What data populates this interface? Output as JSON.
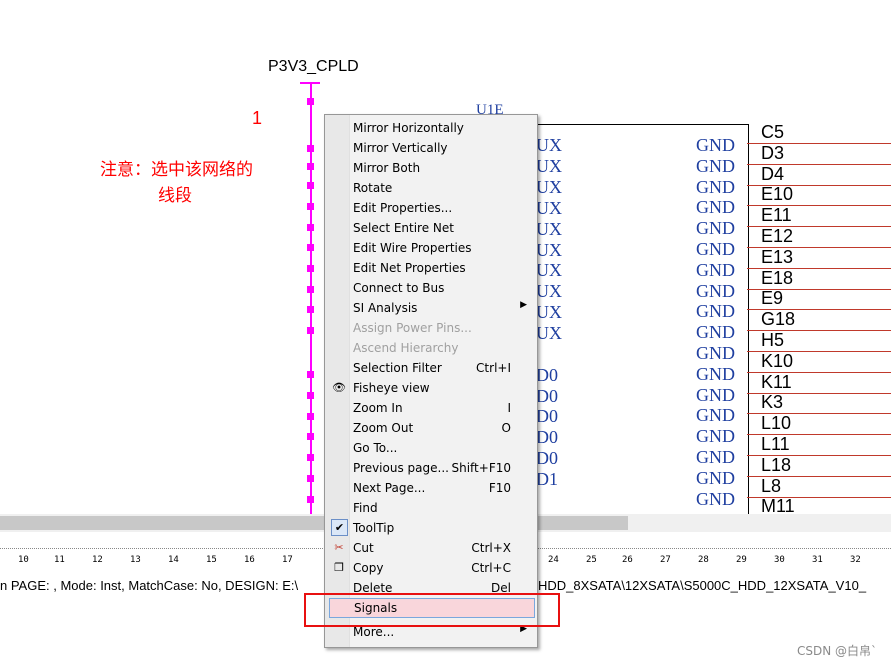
{
  "schematic": {
    "net_name": "P3V3_CPLD",
    "pin_number": "1",
    "note_line1": "注意：选中该网络的",
    "note_line2": "线段",
    "part_ref": "U1E",
    "left_pins": [
      "UX",
      "UX",
      "UX",
      "UX",
      "UX",
      "UX",
      "UX",
      "UX",
      "UX",
      "UX",
      "D0",
      "D0",
      "D0",
      "D0",
      "D0",
      "D1"
    ],
    "right_pins": [
      "GND",
      "GND",
      "GND",
      "GND",
      "GND",
      "GND",
      "GND",
      "GND",
      "GND",
      "GND",
      "GND",
      "GND",
      "GND",
      "GND",
      "GND",
      "GND",
      "GND",
      "GND"
    ],
    "balls": [
      "C5",
      "D3",
      "D4",
      "E10",
      "E11",
      "E12",
      "E13",
      "E18",
      "E9",
      "G18",
      "H5",
      "K10",
      "K11",
      "K3",
      "L10",
      "L11",
      "L18",
      "L8",
      "M11"
    ]
  },
  "ruler": {
    "ticks": [
      "10",
      "11",
      "12",
      "13",
      "14",
      "15",
      "16",
      "17",
      "24",
      "25",
      "26",
      "27",
      "28",
      "29",
      "30",
      "31",
      "32"
    ]
  },
  "status_bar": {
    "left": "n PAGE: , Mode: Inst, MatchCase: No, DESIGN: E:\\",
    "right": "HDD_8XSATA\\12XSATA\\S5000C_HDD_12XSATA_V10_"
  },
  "watermark": "CSDN @白帛`",
  "context_menu": {
    "items": [
      {
        "label": "Mirror Horizontally",
        "shortcut": "",
        "icon": "",
        "state": "normal"
      },
      {
        "label": "Mirror Vertically",
        "shortcut": "",
        "icon": "",
        "state": "normal"
      },
      {
        "label": "Mirror Both",
        "shortcut": "",
        "icon": "",
        "state": "normal"
      },
      {
        "label": "Rotate",
        "shortcut": "",
        "icon": "",
        "state": "normal"
      },
      {
        "label": "Edit Properties...",
        "shortcut": "",
        "icon": "",
        "state": "normal"
      },
      {
        "label": "Select Entire Net",
        "shortcut": "",
        "icon": "",
        "state": "normal"
      },
      {
        "label": "Edit Wire Properties",
        "shortcut": "",
        "icon": "",
        "state": "normal"
      },
      {
        "label": "Edit Net Properties",
        "shortcut": "",
        "icon": "",
        "state": "normal"
      },
      {
        "label": "Connect to Bus",
        "shortcut": "",
        "icon": "",
        "state": "normal"
      },
      {
        "label": "SI Analysis",
        "shortcut": "",
        "icon": "",
        "state": "submenu"
      },
      {
        "label": "Assign Power Pins...",
        "shortcut": "",
        "icon": "",
        "state": "disabled"
      },
      {
        "label": "Ascend Hierarchy",
        "shortcut": "",
        "icon": "",
        "state": "disabled"
      },
      {
        "label": "Selection Filter",
        "shortcut": "Ctrl+I",
        "icon": "",
        "state": "normal"
      },
      {
        "label": "Fisheye view",
        "shortcut": "",
        "icon": "eye-icon",
        "state": "normal"
      },
      {
        "label": "Zoom In",
        "shortcut": "I",
        "icon": "",
        "state": "normal"
      },
      {
        "label": "Zoom Out",
        "shortcut": "O",
        "icon": "",
        "state": "normal"
      },
      {
        "label": "Go To...",
        "shortcut": "",
        "icon": "",
        "state": "normal"
      },
      {
        "label": "Previous page...",
        "shortcut": "Shift+F10",
        "icon": "",
        "state": "normal"
      },
      {
        "label": "Next Page...",
        "shortcut": "F10",
        "icon": "",
        "state": "normal"
      },
      {
        "label": "Find",
        "shortcut": "",
        "icon": "",
        "state": "normal"
      },
      {
        "label": "ToolTip",
        "shortcut": "",
        "icon": "checkmark-icon",
        "state": "checked"
      },
      {
        "label": "Cut",
        "shortcut": "Ctrl+X",
        "icon": "scissors-icon",
        "state": "normal"
      },
      {
        "label": "Copy",
        "shortcut": "Ctrl+C",
        "icon": "copy-icon",
        "state": "normal"
      },
      {
        "label": "Delete",
        "shortcut": "Del",
        "icon": "",
        "state": "normal"
      },
      {
        "label": "Signals",
        "shortcut": "",
        "icon": "",
        "state": "highlight"
      },
      {
        "label": "More...",
        "shortcut": "",
        "icon": "",
        "state": "submenu"
      }
    ]
  },
  "colors": {
    "net": "#ff00ff",
    "highlight": "#e81010",
    "pin_text": "#1f3fa0"
  }
}
